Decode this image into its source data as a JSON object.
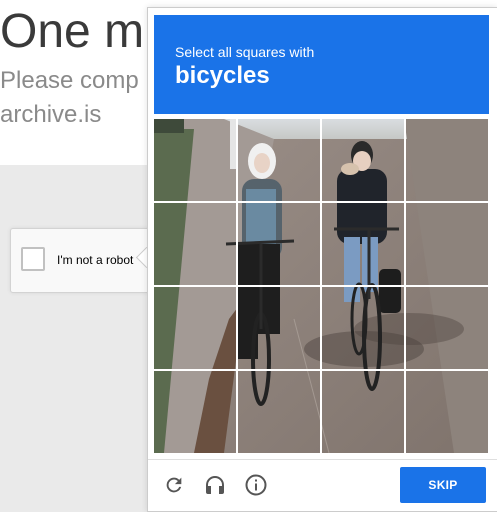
{
  "background_page": {
    "heading": "One m",
    "subtitle": "Please comp",
    "site": "archive.is"
  },
  "anchor": {
    "label": "I'm not a robot",
    "checked": false
  },
  "challenge": {
    "instruction": "Select all squares with",
    "target": "bicycles",
    "grid_rows": 4,
    "grid_cols": 4,
    "tiles_selected": [],
    "footer": {
      "icons": [
        "reload-icon",
        "audio-headphones-icon",
        "info-icon"
      ],
      "skip_label": "SKIP"
    }
  },
  "colors": {
    "accent": "#1a73e8",
    "page_background": "#eaeaea"
  }
}
